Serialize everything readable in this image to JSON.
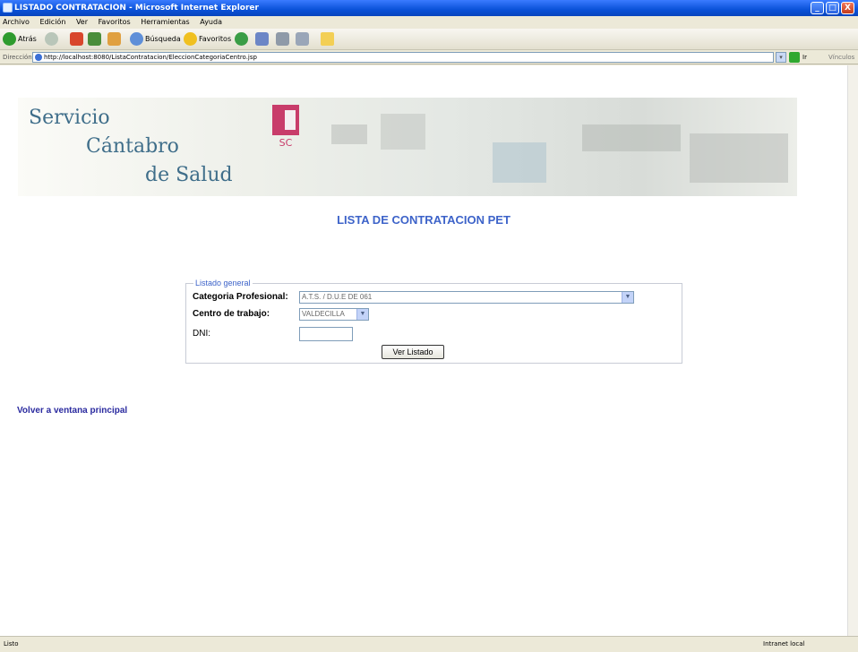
{
  "window": {
    "title": "LISTADO CONTRATACION - Microsoft Internet Explorer",
    "controls": [
      "_",
      "□",
      "X"
    ]
  },
  "menu": [
    "Archivo",
    "Edición",
    "Ver",
    "Favoritos",
    "Herramientas",
    "Ayuda"
  ],
  "toolbar": {
    "back_label": "Atrás",
    "search_label": "Búsqueda",
    "favorites_label": "Favoritos"
  },
  "address": {
    "label": "Dirección",
    "url": "http://localhost:8080/ListaContratacion/EleccionCategoriaCentro.jsp",
    "go_label": "Ir",
    "links_label": "Vínculos"
  },
  "banner": {
    "line1": "Servicio",
    "line2": "Cántabro",
    "line3": "de Salud",
    "logo_text": "SC"
  },
  "page": {
    "heading": "LISTA DE CONTRATACION PET"
  },
  "form": {
    "legend": "Listado general",
    "categoria_label": "Categoria Profesional:",
    "categoria_value": "A.T.S. / D.U.E DE 061",
    "centro_label": "Centro de trabajo:",
    "centro_value": "VALDECILLA",
    "dni_label": "DNI:",
    "dni_value": "",
    "submit_label": "Ver Listado"
  },
  "links": {
    "back": "Volver a ventana principal"
  },
  "status": {
    "left": "Listo",
    "right": "Intranet local"
  },
  "colors": {
    "heading": "#3d63c9",
    "link": "#2a2a9f",
    "logo_text": "#3f6e8a",
    "logo_mark": "#c83c6a"
  }
}
